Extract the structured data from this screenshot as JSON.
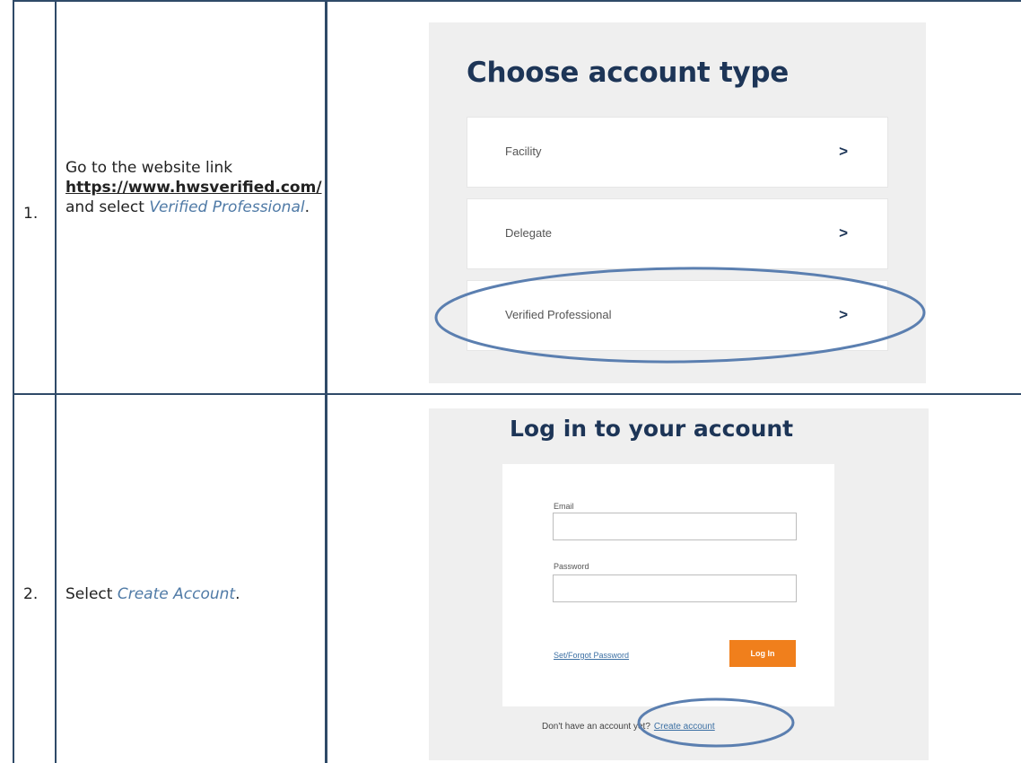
{
  "rows": [
    {
      "number": "1.",
      "text_before": "Go to the website link ",
      "link": "https://www.hwsverified.com/",
      "text_middle": " and select ",
      "emphasis": "Verified Professional",
      "text_after": "."
    },
    {
      "number": "2.",
      "text_before": "Select ",
      "emphasis": "Create Account",
      "text_after": "."
    }
  ],
  "screen1": {
    "title": "Choose account type",
    "options": [
      {
        "label": "Facility",
        "chevron": ">"
      },
      {
        "label": "Delegate",
        "chevron": ">"
      },
      {
        "label": "Verified Professional",
        "chevron": ">"
      }
    ]
  },
  "screen2": {
    "title": "Log in to your account",
    "email_label": "Email",
    "password_label": "Password",
    "forgot_link": "Set/Forgot Password",
    "login_button": "Log In",
    "signup_prompt": "Don't have an account yet?",
    "create_link": "Create account"
  },
  "colors": {
    "border": "#2f4a68",
    "title": "#1d3557",
    "accent_orange": "#f07f1c",
    "annotation": "#5b7fb0"
  }
}
